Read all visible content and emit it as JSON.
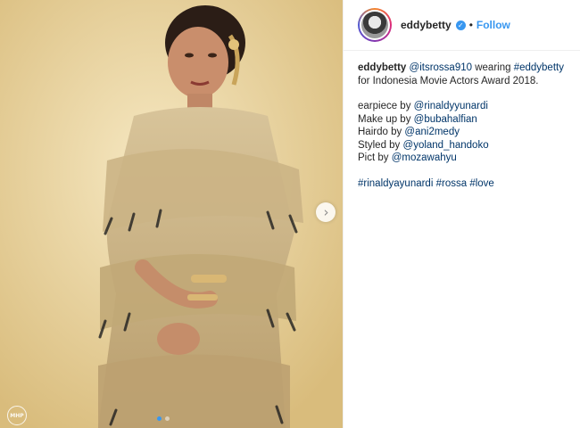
{
  "post": {
    "author": "eddybetty",
    "separator": "•",
    "follow_label": "Follow",
    "caption_intro_mention": "@itsrossa910",
    "caption_intro_word": "wearing",
    "caption_intro_tag": "#eddybetty",
    "caption_intro_rest": "for Indonesia Movie Actors Award 2018.",
    "credits": [
      {
        "label": "earpiece by",
        "handle": "@rinaldyyunardi"
      },
      {
        "label": "Make up by",
        "handle": "@bubahalfian"
      },
      {
        "label": "Hairdo by",
        "handle": "@ani2medy"
      },
      {
        "label": "Styled by",
        "handle": "@yoland_handoko"
      },
      {
        "label": "Pict by",
        "handle": "@mozawahyu"
      }
    ],
    "hashtags": [
      "#rinaldyayunardi",
      "#rossa",
      "#love"
    ]
  },
  "media": {
    "watermark": "MHP",
    "next_icon": "chevron-right-icon",
    "carousel_count": 2,
    "carousel_active": 1
  },
  "colors": {
    "link": "#003569",
    "follow": "#3897f0",
    "verified": "#3897f0"
  }
}
